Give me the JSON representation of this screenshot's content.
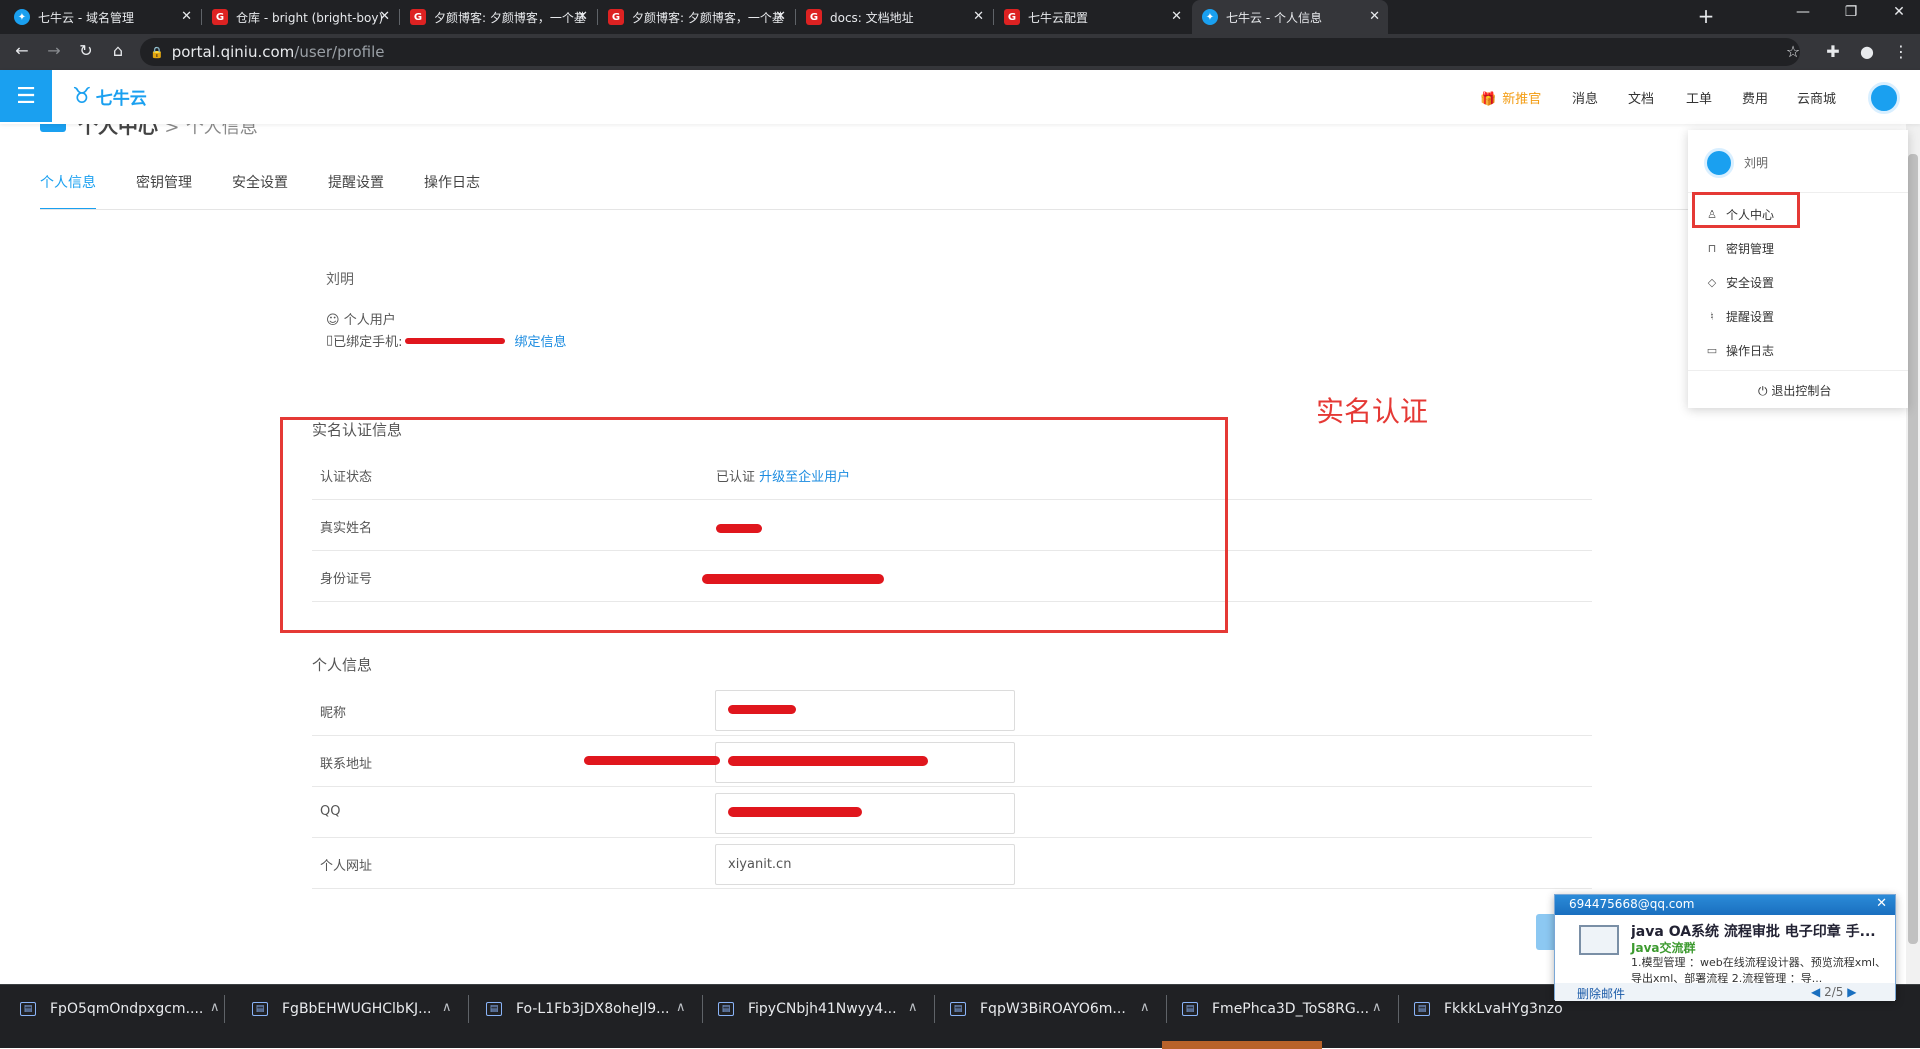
{
  "browser": {
    "tabs": [
      {
        "title": "七牛云 - 域名管理",
        "icon": "qiniu"
      },
      {
        "title": "仓库 - bright (bright-boy) - Git",
        "icon": "gitee"
      },
      {
        "title": "夕颜博客: 夕颜博客，一个基于微",
        "icon": "gitee"
      },
      {
        "title": "夕颜博客: 夕颜博客，一个基于微",
        "icon": "gitee"
      },
      {
        "title": "docs: 文档地址",
        "icon": "gitee"
      },
      {
        "title": "七牛云配置",
        "icon": "gitee"
      },
      {
        "title": "七牛云 - 个人信息",
        "icon": "qiniu",
        "active": true
      }
    ],
    "url_host": "portal.qiniu.com",
    "url_path": "/user/profile"
  },
  "header": {
    "brand": "七牛云",
    "promo": "新推官",
    "nav": [
      "消息",
      "文档",
      "工单",
      "费用",
      "云商城"
    ]
  },
  "breadcrumb": {
    "main": "个人中心",
    "sep": ">",
    "sub": "个人信息"
  },
  "tabs": [
    "个人信息",
    "密钥管理",
    "安全设置",
    "提醒设置",
    "操作日志"
  ],
  "profile": {
    "name": "刘明",
    "user_type": "个人用户",
    "phone_label": "已绑定手机:",
    "bind_link": "绑定信息"
  },
  "realname": {
    "section_title": "实名认证信息",
    "annotation": "实名认证",
    "rows": [
      {
        "label": "认证状态",
        "status": "已认证",
        "link": "升级至企业用户"
      },
      {
        "label": "真实姓名"
      },
      {
        "label": "身份证号"
      }
    ]
  },
  "personal": {
    "section_title": "个人信息",
    "rows": [
      {
        "label": "昵称",
        "value": ""
      },
      {
        "label": "联系地址",
        "value": ""
      },
      {
        "label": "QQ",
        "value": ""
      },
      {
        "label": "个人网址",
        "value": "xiyanit.cn"
      }
    ]
  },
  "dropdown": {
    "name": "刘明",
    "items": [
      "个人中心",
      "密钥管理",
      "安全设置",
      "提醒设置",
      "操作日志"
    ],
    "logout": "退出控制台"
  },
  "downloads": [
    "FpO5qmOndpxgcm....",
    "FgBbEHWUGHClbKJ...",
    "Fo-L1Fb3jDX8oheJl9...",
    "FipyCNbjh41Nwyy4...",
    "FqpW3BiROAYO6m...",
    "FmePhca3D_ToS8RG...",
    "FkkkLvaHYg3nzo"
  ],
  "notification": {
    "email": "694475668@qq.com",
    "title": "java OA系统 流程审批 电子印章 手...",
    "group": "Java交流群",
    "body": "1.模型管理 ：web在线流程设计器、预览流程xml、导出xml、部署流程 2.流程管理 ：导...",
    "delete": "删除邮件",
    "pager": "2/5"
  },
  "colors": {
    "brand": "#1aa0f0",
    "annotation": "#e53935",
    "link": "#1a8be0"
  }
}
